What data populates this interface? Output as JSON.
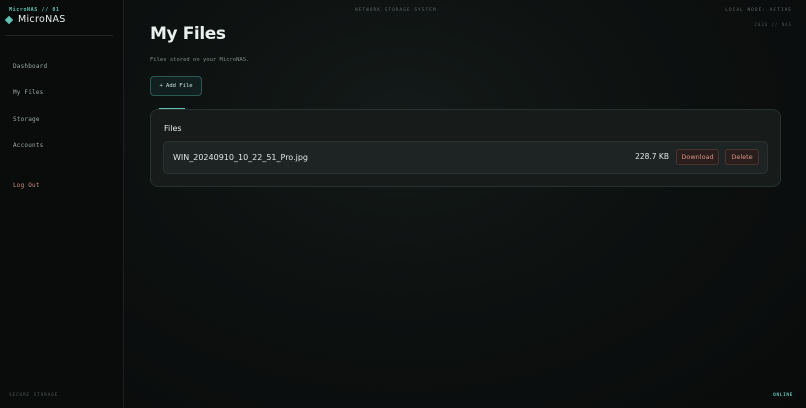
{
  "sidebar": {
    "brand_tag": "MicroNAS // 01",
    "brand_name": "MicroNAS",
    "brand_icon": "diamond-icon",
    "items": [
      {
        "label": "Dashboard"
      },
      {
        "label": "My Files"
      },
      {
        "label": "Storage"
      },
      {
        "label": "Accounts"
      }
    ],
    "logout_label": "Log Out",
    "footer": "SECURE STORAGE"
  },
  "topbar": {
    "center": "NETWORK STORAGE SYSTEM",
    "right": "LOCAL NODE: ACTIVE",
    "right_sub": "2026 // NAS"
  },
  "main": {
    "title": "My Files",
    "subtitle": "Files stored on your MicroNAS.",
    "add_button": "+ Add File",
    "files_heading": "Files",
    "files": [
      {
        "name": "WIN_20240910_10_22_51_Pro.jpg",
        "size": "228.7 KB",
        "download_label": "Download",
        "delete_label": "Delete"
      }
    ]
  },
  "status": "ONLINE",
  "colors": {
    "accent": "#5fc2b2",
    "danger": "#d68f86",
    "background": "#0b0d0d"
  }
}
